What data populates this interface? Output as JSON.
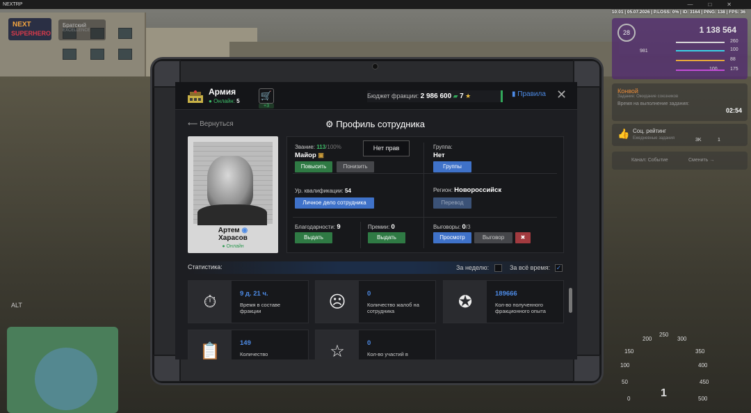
{
  "window": {
    "title": "NEXTRP"
  },
  "perf": {
    "text": "10:01 | 05.07.2026 | P.LOSS: 0% | ID: 3164 | PING: 138 | FPS: 36"
  },
  "hud": {
    "logo_top": "NEXT",
    "logo_bottom": "SUPERHERO",
    "server_name": "Братский",
    "server_sub": "EXCELLENCE",
    "level": "28",
    "money": "1 138 564",
    "stat_a": "981",
    "stat_b": "260",
    "stat_c": "100",
    "stat_d": "88",
    "stat_e": "100",
    "stat_f": "175",
    "convoy_title": "Конвой",
    "convoy_sub": "Задание: Ожидание союзников",
    "convoy_timer_label": "Время на выполнение задания:",
    "convoy_timer": "02:54",
    "rating_title": "Соц. рейтинг",
    "rating_sub": "Ежедневные задания",
    "rating_val1": "3K",
    "rating_val2": "1",
    "channel": "Канал: Событие",
    "channel_switch": "Сменить →",
    "alt_hint": "ALT",
    "speed_ticks": [
      "0",
      "50",
      "100",
      "150",
      "200",
      "250",
      "300",
      "350",
      "400",
      "450",
      "500"
    ],
    "gear": "1"
  },
  "header": {
    "faction": "Армия",
    "online_label": "Онлайн:",
    "online_count": "5",
    "cart_badge": "+3",
    "budget_label": "Бюджет фракции:",
    "budget_value": "2 986 600",
    "budget_extra": "7",
    "rules": "Правила"
  },
  "page": {
    "back": "Вернуться",
    "title": "Профиль сотрудника"
  },
  "profile": {
    "name_first": "Артем",
    "name_last": "Харасов",
    "status": "Онлайн"
  },
  "info": {
    "rank_label": "Звание:",
    "rank_progress": "113",
    "rank_max": "/100%",
    "rank_name": "Майор",
    "btn_promote": "Повысить",
    "btn_demote": "Понизить",
    "group_label": "Группа:",
    "group_value": "Нет",
    "btn_groups": "Группы",
    "qual_label": "Ур. квалификации:",
    "qual_value": "54",
    "btn_file": "Личное дело сотрудника",
    "region_label": "Регион:",
    "region_value": "Новороссийск",
    "btn_transfer": "Перевод",
    "tooltip": "Нет прав",
    "thanks_label": "Благодарности:",
    "thanks_value": "9",
    "btn_give1": "Выдать",
    "bonus_label": "Премии:",
    "bonus_value": "0",
    "btn_give2": "Выдать",
    "warn_label": "Выговоры:",
    "warn_value": "0",
    "warn_max": "/3",
    "btn_view": "Просмотр",
    "btn_warn": "Выговор"
  },
  "stats": {
    "label": "Статистика:",
    "week": "За неделю:",
    "all": "За всё время:",
    "tiles": [
      {
        "value": "9 д. 21 ч.",
        "desc": "Время в составе фракции",
        "icon": "stopwatch-icon"
      },
      {
        "value": "0",
        "desc": "Количество жалоб на сотрудника",
        "icon": "complaint-icon"
      },
      {
        "value": "189666",
        "desc": "Кол-во полученного фракционного опыта",
        "icon": "exp-icon"
      },
      {
        "value": "149",
        "desc": "Количество",
        "icon": "clipboard-icon"
      },
      {
        "value": "0",
        "desc": "Кол-во участий в",
        "icon": "star-icon"
      }
    ]
  }
}
